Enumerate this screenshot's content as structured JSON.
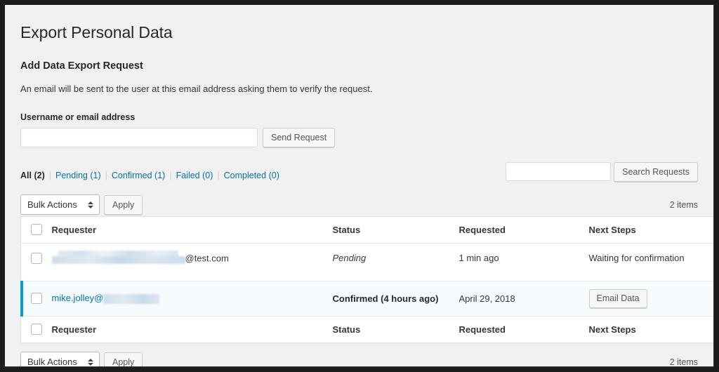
{
  "page": {
    "title": "Export Personal Data",
    "section_heading": "Add Data Export Request",
    "description": "An email will be sent to the user at this email address asking them to verify the request."
  },
  "form": {
    "label": "Username or email address",
    "input_value": "",
    "input_placeholder": "",
    "submit_label": "Send Request"
  },
  "filters": [
    {
      "label": "All",
      "count": "(2)",
      "current": true
    },
    {
      "label": "Pending",
      "count": "(1)",
      "current": false
    },
    {
      "label": "Confirmed",
      "count": "(1)",
      "current": false
    },
    {
      "label": "Failed",
      "count": "(0)",
      "current": false
    },
    {
      "label": "Completed",
      "count": "(0)",
      "current": false
    }
  ],
  "search": {
    "value": "",
    "placeholder": "",
    "button_label": "Search Requests"
  },
  "tablenav_top": {
    "bulk_actions_label": "Bulk Actions",
    "apply_label": "Apply",
    "items_count": "2 items"
  },
  "tablenav_bottom": {
    "bulk_actions_label": "Bulk Actions",
    "apply_label": "Apply",
    "items_count": "2 items"
  },
  "table": {
    "columns": {
      "requester": "Requester",
      "status": "Status",
      "requested": "Requested",
      "next_steps": "Next Steps"
    },
    "rows": [
      {
        "requester_redacted": true,
        "requester_visible_suffix": "@test.com",
        "status": "Pending",
        "requested": "1 min ago",
        "next_steps": "Waiting for confirmation",
        "next_steps_is_button": false,
        "highlighted": false
      },
      {
        "requester_redacted": true,
        "requester_visible_prefix": "mike.jolley@",
        "status": "Confirmed (4 hours ago)",
        "requested": "April 29, 2018",
        "next_steps": "Email Data",
        "next_steps_is_button": true,
        "highlighted": true
      }
    ]
  },
  "colors": {
    "accent_blue": "#00a0d2",
    "link_blue": "#0073aa",
    "page_bg": "#f1f1f1",
    "row_highlight": "#f6fbfd"
  }
}
